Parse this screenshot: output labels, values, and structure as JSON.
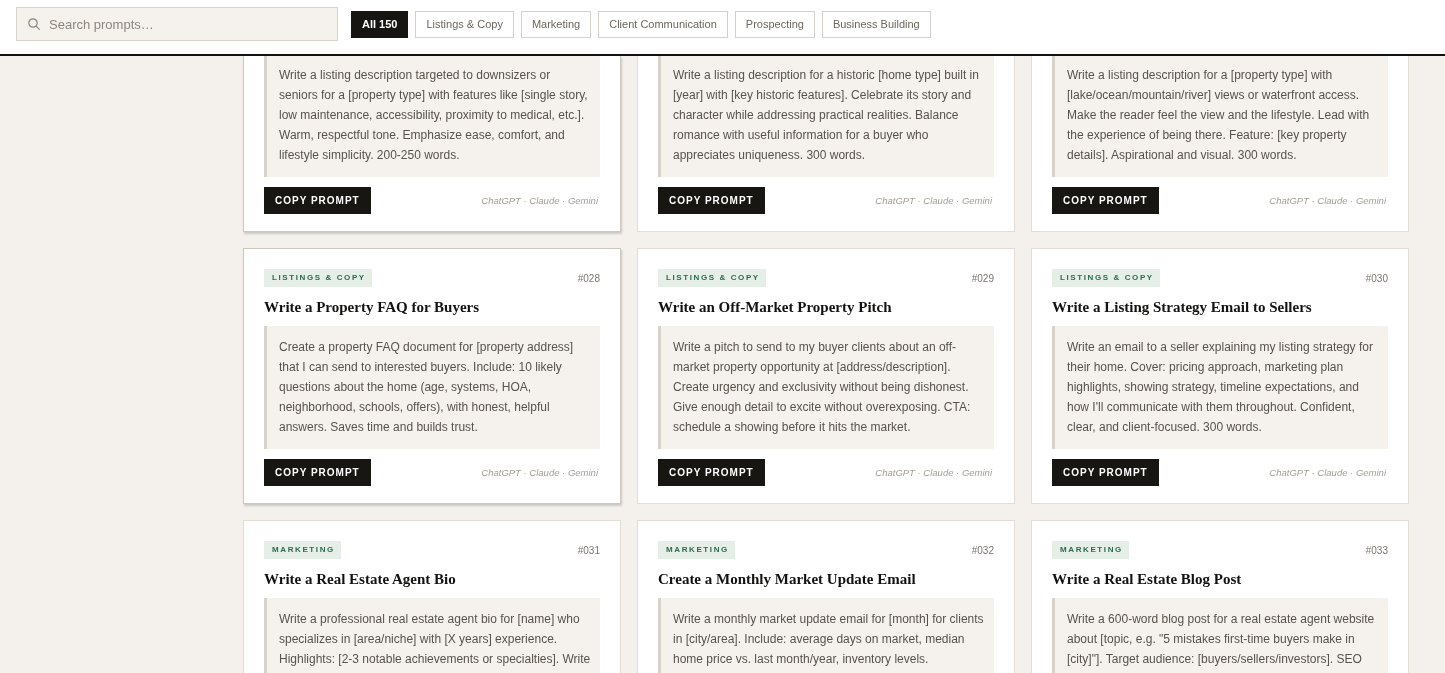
{
  "search": {
    "placeholder": "Search prompts…"
  },
  "filters": [
    {
      "label": "All 150",
      "selected": true
    },
    {
      "label": "Listings & Copy",
      "selected": false
    },
    {
      "label": "Marketing",
      "selected": false
    },
    {
      "label": "Client Communication",
      "selected": false
    },
    {
      "label": "Prospecting",
      "selected": false
    },
    {
      "label": "Business Building",
      "selected": false
    }
  ],
  "cards": [
    {
      "highlighted": true,
      "prompt": "Write a listing description targeted to downsizers or seniors for a [property type] with features like [single story, low maintenance, accessibility, proximity to medical, etc.]. Warm, respectful tone. Emphasize ease, comfort, and lifestyle simplicity. 200-250 words.",
      "button": "COPY PROMPT",
      "models": "ChatGPT · Claude · Gemini"
    },
    {
      "highlighted": false,
      "prompt": "Write a listing description for a historic [home type] built in [year] with [key historic features]. Celebrate its story and character while addressing practical realities. Balance romance with useful information for a buyer who appreciates uniqueness. 300 words.",
      "button": "COPY PROMPT",
      "models": "ChatGPT · Claude · Gemini"
    },
    {
      "highlighted": false,
      "prompt": "Write a listing description for a [property type] with [lake/ocean/mountain/river] views or waterfront access. Make the reader feel the view and the lifestyle. Lead with the experience of being there. Feature: [key property details]. Aspirational and visual. 300 words.",
      "button": "COPY PROMPT",
      "models": "ChatGPT · Claude · Gemini"
    },
    {
      "highlighted": true,
      "tag": "LISTINGS & COPY",
      "number": "#028",
      "title": "Write a Property FAQ for Buyers",
      "prompt": "Create a property FAQ document for [property address] that I can send to interested buyers. Include: 10 likely questions about the home (age, systems, HOA, neighborhood, schools, offers), with honest, helpful answers. Saves time and builds trust.",
      "button": "COPY PROMPT",
      "models": "ChatGPT · Claude · Gemini"
    },
    {
      "highlighted": false,
      "tag": "LISTINGS & COPY",
      "number": "#029",
      "title": "Write an Off-Market Property Pitch",
      "prompt": "Write a pitch to send to my buyer clients about an off-market property opportunity at [address/description]. Create urgency and exclusivity without being dishonest. Give enough detail to excite without overexposing. CTA: schedule a showing before it hits the market.",
      "button": "COPY PROMPT",
      "models": "ChatGPT · Claude · Gemini"
    },
    {
      "highlighted": false,
      "tag": "LISTINGS & COPY",
      "number": "#030",
      "title": "Write a Listing Strategy Email to Sellers",
      "prompt": "Write an email to a seller explaining my listing strategy for their home. Cover: pricing approach, marketing plan highlights, showing strategy, timeline expectations, and how I'll communicate with them throughout. Confident, clear, and client-focused. 300 words.",
      "button": "COPY PROMPT",
      "models": "ChatGPT · Claude · Gemini"
    },
    {
      "highlighted": false,
      "tag": "MARKETING",
      "number": "#031",
      "title": "Write a Real Estate Agent Bio",
      "prompt": "Write a professional real estate agent bio for [name] who specializes in [area/niche] with [X years] experience. Highlights: [2-3 notable achievements or specialties]. Write"
    },
    {
      "highlighted": false,
      "tag": "MARKETING",
      "number": "#032",
      "title": "Create a Monthly Market Update Email",
      "prompt": "Write a monthly market update email for [month] for clients in [city/area]. Include: average days on market, median home price vs. last month/year, inventory levels."
    },
    {
      "highlighted": false,
      "tag": "MARKETING",
      "number": "#033",
      "title": "Write a Real Estate Blog Post",
      "prompt": "Write a 600-word blog post for a real estate agent website about [topic, e.g. \"5 mistakes first-time buyers make in [city]\"]. Target audience: [buyers/sellers/investors]. SEO"
    }
  ]
}
